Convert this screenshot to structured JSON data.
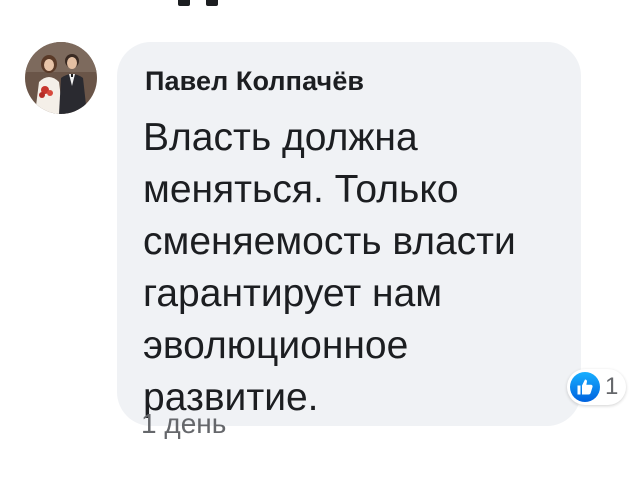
{
  "comment": {
    "author": "Павел Колпачёв",
    "text": "Власть должна\nменяться. Только\nсменяемость власти\nгарантирует нам\nэволюционное\nразвитие.",
    "avatar_icon": "wedding-photo-avatar",
    "reactions": {
      "icon": "like-icon",
      "count": "1",
      "color": "#1877f2"
    },
    "timestamp": "1 день"
  },
  "colors": {
    "bubble": "#f0f2f5",
    "text": "#1c1e21",
    "secondary": "#65676b"
  }
}
